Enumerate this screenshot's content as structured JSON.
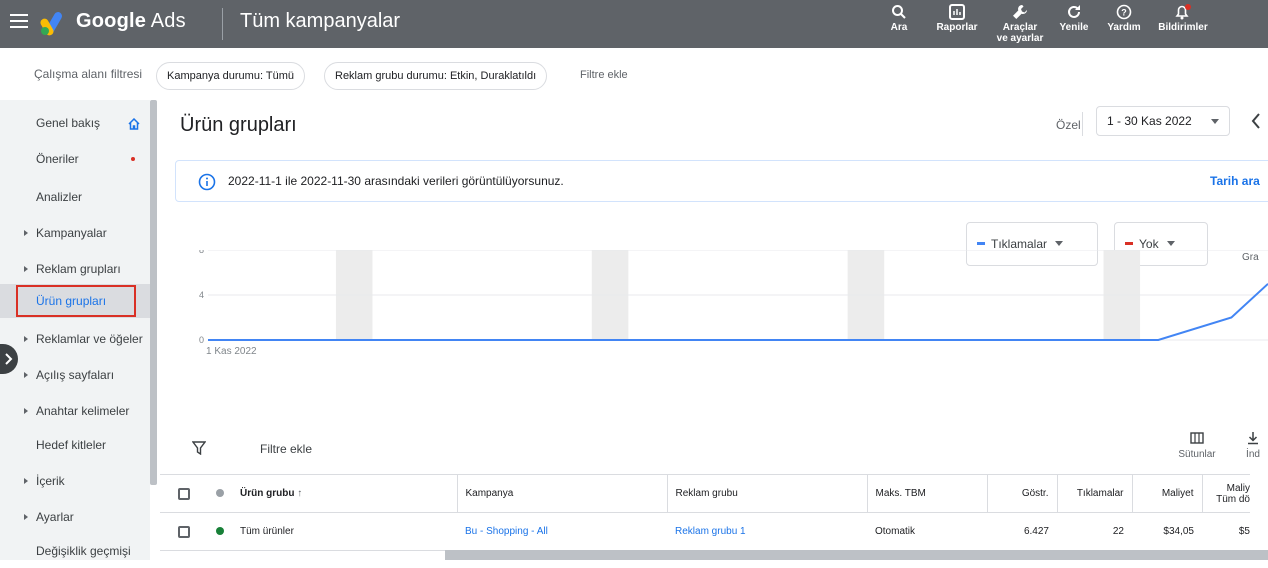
{
  "header": {
    "brand_prefix": "Google",
    "brand_suffix": "Ads",
    "title": "Tüm kampanyalar",
    "buttons": [
      {
        "label": "Ara",
        "icon": "search-icon"
      },
      {
        "label": "Raporlar",
        "icon": "reports-icon"
      },
      {
        "label": "Araçlar",
        "label2": "ve ayarlar",
        "icon": "tools-icon"
      },
      {
        "label": "Yenile",
        "icon": "refresh-icon"
      },
      {
        "label": "Yardım",
        "icon": "help-icon"
      },
      {
        "label": "Bildirimler",
        "icon": "notifications-icon"
      }
    ]
  },
  "filterbar": {
    "label": "Çalışma alanı filtresi",
    "chips": [
      "Kampanya durumu: Tümü",
      "Reklam grubu durumu: Etkin, Duraklatıldı"
    ],
    "add_filter": "Filtre ekle"
  },
  "sidebar": {
    "items": [
      {
        "label": "Genel bakış",
        "expandable": false
      },
      {
        "label": "Öneriler",
        "expandable": false
      },
      {
        "label": "Analizler",
        "expandable": false
      },
      {
        "label": "Kampanyalar",
        "expandable": true
      },
      {
        "label": "Reklam grupları",
        "expandable": true
      },
      {
        "label": "Ürün grupları",
        "expandable": false,
        "active": true
      },
      {
        "label": "Reklamlar ve öğeler",
        "expandable": true
      },
      {
        "label": "Açılış sayfaları",
        "expandable": true
      },
      {
        "label": "Anahtar kelimeler",
        "expandable": true
      },
      {
        "label": "Hedef kitleler",
        "expandable": false
      },
      {
        "label": "İçerik",
        "expandable": true
      },
      {
        "label": "Ayarlar",
        "expandable": true
      },
      {
        "label": "Değişiklik geçmişi",
        "expandable": false
      }
    ]
  },
  "main": {
    "title": "Ürün grupları",
    "date_type": "Özel",
    "date_range": "1 - 30 Kas 2022",
    "info_text": "2022-11-1 ile 2022-11-30 arasındaki verileri görüntülüyorsunuz.",
    "info_link": "Tarih ara",
    "metric1": "Tıklamalar",
    "metric2": "Yok",
    "chart_cut_label": "Gra",
    "filter_add": "Filtre ekle",
    "columns_label": "Sütunlar",
    "download_label": "İnd"
  },
  "chart_data": {
    "type": "line",
    "y_ticks": [
      "8",
      "4",
      "0"
    ],
    "x_start_label": "1 Kas 2022",
    "ylim": [
      0,
      8
    ],
    "series": [
      {
        "name": "Tıklamalar",
        "color": "#4285f4",
        "x": [
          1,
          27,
          29,
          30
        ],
        "y": [
          0,
          0,
          2,
          5
        ]
      }
    ]
  },
  "table": {
    "headers": [
      "Ürün grubu",
      "Kampanya",
      "Reklam grubu",
      "Maks. TBM",
      "Göstr.",
      "Tıklamalar",
      "Maliyet",
      "Maliy",
      "Tüm dö"
    ],
    "rows": [
      {
        "product_group": "Tüm ürünler",
        "campaign": "Bu - Shopping - All",
        "ad_group": "Reklam grubu 1",
        "max_cpc": "Otomatik",
        "impressions": "6.427",
        "clicks": "22",
        "cost": "$34,05",
        "cost2": "$5"
      }
    ]
  },
  "colors": {
    "topbar": "#5f6368",
    "accent": "#1a73e8",
    "series": "#4285f4",
    "red": "#d93025",
    "green": "#188038"
  }
}
